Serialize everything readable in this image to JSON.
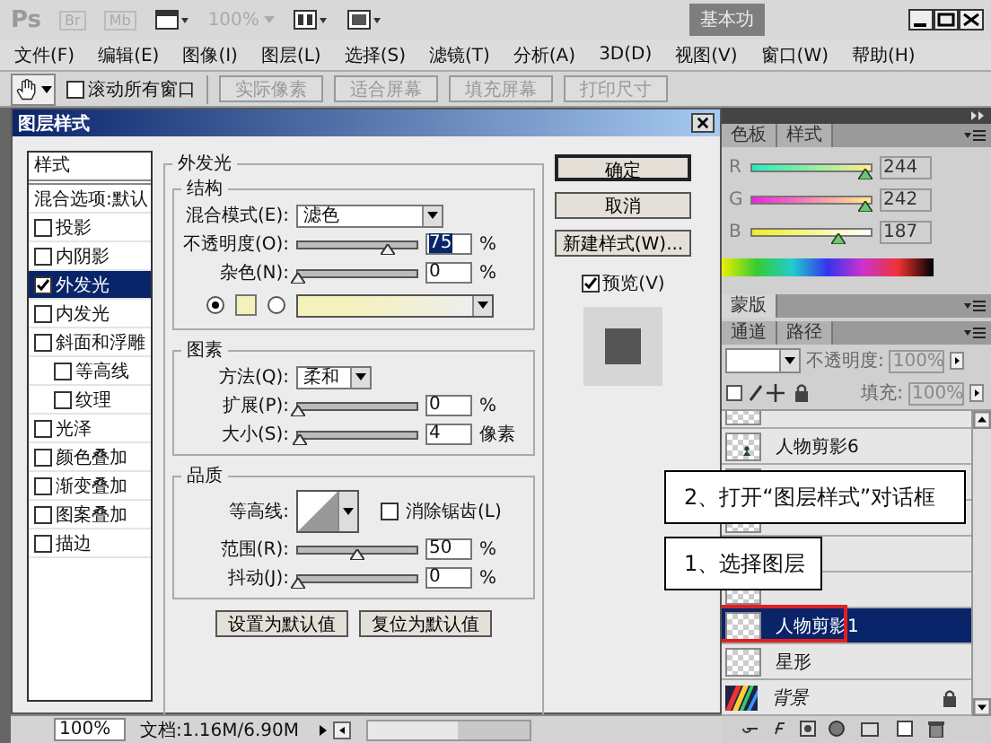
{
  "app_bar": {
    "logo": "Ps",
    "bridge": "Br",
    "mini_bridge": "Mb",
    "zoom": "100%",
    "workspace": "基本功"
  },
  "menu": [
    "文件(F)",
    "编辑(E)",
    "图像(I)",
    "图层(L)",
    "选择(S)",
    "滤镜(T)",
    "分析(A)",
    "3D(D)",
    "视图(V)",
    "窗口(W)",
    "帮助(H)"
  ],
  "options_bar": {
    "scroll_all": {
      "label": "滚动所有窗口",
      "checked": false
    },
    "buttons": [
      {
        "label": "实际像素",
        "disabled": true
      },
      {
        "label": "适合屏幕",
        "disabled": true
      },
      {
        "label": "填充屏幕",
        "disabled": true
      },
      {
        "label": "打印尺寸",
        "disabled": true
      }
    ]
  },
  "dialog": {
    "title": "图层样式",
    "styles_header": "样式",
    "styles": [
      {
        "label": "混合选项:默认",
        "kind": "header",
        "selected": false
      },
      {
        "label": "投影",
        "kind": "checkbox",
        "checked": false,
        "selected": false
      },
      {
        "label": "内阴影",
        "kind": "checkbox",
        "checked": false,
        "selected": false
      },
      {
        "label": "外发光",
        "kind": "checkbox",
        "checked": true,
        "selected": true
      },
      {
        "label": "内发光",
        "kind": "checkbox",
        "checked": false,
        "selected": false
      },
      {
        "label": "斜面和浮雕",
        "kind": "checkbox",
        "checked": false,
        "selected": false,
        "children": [
          {
            "label": "等高线",
            "kind": "checkbox",
            "checked": false,
            "selected": false
          },
          {
            "label": "纹理",
            "kind": "checkbox",
            "checked": false,
            "selected": false
          }
        ]
      },
      {
        "label": "光泽",
        "kind": "checkbox",
        "checked": false,
        "selected": false
      },
      {
        "label": "颜色叠加",
        "kind": "checkbox",
        "checked": false,
        "selected": false
      },
      {
        "label": "渐变叠加",
        "kind": "checkbox",
        "checked": false,
        "selected": false
      },
      {
        "label": "图案叠加",
        "kind": "checkbox",
        "checked": false,
        "selected": false
      },
      {
        "label": "描边",
        "kind": "checkbox",
        "checked": false,
        "selected": false
      }
    ],
    "section_title": "外发光",
    "groups": [
      {
        "title": "结构",
        "rows": [
          {
            "kind": "dropdown",
            "label": "混合模式(E):",
            "value": "滤色"
          },
          {
            "kind": "slider",
            "label": "不透明度(O):",
            "level": 0.75,
            "value": "75",
            "unit": "%",
            "value_selected": true
          },
          {
            "kind": "slider",
            "label": "杂色(N):",
            "level": 0,
            "value": "0",
            "unit": "%",
            "value_selected": false
          },
          {
            "kind": "color",
            "solid_selected": true
          }
        ]
      },
      {
        "title": "图素",
        "rows": [
          {
            "kind": "small_dropdown",
            "label": "方法(Q):",
            "value": "柔和"
          },
          {
            "kind": "slider",
            "label": "扩展(P):",
            "level": 0,
            "value": "0",
            "unit": "%",
            "value_selected": false
          },
          {
            "kind": "slider",
            "label": "大小(S):",
            "level": 0.02,
            "value": "4",
            "unit": "像素",
            "value_selected": false
          }
        ]
      },
      {
        "title": "品质",
        "rows": [
          {
            "kind": "contour",
            "label": "等高线:",
            "anti_alias": {
              "label": "消除锯齿(L)",
              "checked": false
            }
          },
          {
            "kind": "slider",
            "label": "范围(R):",
            "level": 0.5,
            "value": "50",
            "unit": "%",
            "value_selected": false
          },
          {
            "kind": "slider",
            "label": "抖动(J):",
            "level": 0,
            "value": "0",
            "unit": "%",
            "value_selected": false
          }
        ]
      }
    ],
    "defaults_buttons": [
      "设置为默认值",
      "复位为默认值"
    ],
    "actions": [
      {
        "label": "确定",
        "default": true
      },
      {
        "label": "取消",
        "default": false
      },
      {
        "label": "新建样式(W)...",
        "default": false
      }
    ],
    "preview": {
      "label": "预览(V)",
      "checked": true
    }
  },
  "color_panel": {
    "tabs": [
      {
        "label": "色板",
        "selected": false
      },
      {
        "label": "样式",
        "selected": false
      }
    ],
    "channels": [
      {
        "name": "R",
        "level": 0.957,
        "value": "244"
      },
      {
        "name": "G",
        "level": 0.949,
        "value": "242"
      },
      {
        "name": "B",
        "level": 0.733,
        "value": "187"
      }
    ]
  },
  "mask_panel": {
    "tab": "蒙版"
  },
  "layers_panel": {
    "tabs": [
      {
        "label": "通道",
        "selected": false
      },
      {
        "label": "路径",
        "selected": false
      }
    ],
    "opacity_label": "不透明度:",
    "opacity": "100%",
    "fill_label": "填充:",
    "fill": "100%",
    "layers": [
      {
        "kind": "transparent",
        "selected": false
      },
      {
        "kind": "figure",
        "name": "人物剪影6",
        "selected": false
      },
      {
        "kind": "transparent",
        "selected": false
      },
      {
        "kind": "transparent",
        "selected": false
      },
      {
        "selected": false
      },
      {
        "kind": "transparent",
        "selected": false
      },
      {
        "kind": "transparent",
        "name": "人物剪影1",
        "selected": true
      },
      {
        "kind": "transparent",
        "name": "星形",
        "selected": false
      },
      {
        "kind": "background",
        "name": "背景",
        "selected": false,
        "locked": true
      }
    ]
  },
  "annotations": [
    "2、打开“图层样式”对话框",
    "1、选择图层"
  ],
  "status_bar": {
    "zoom": "100%",
    "document": "文档:1.16M/6.90M"
  }
}
